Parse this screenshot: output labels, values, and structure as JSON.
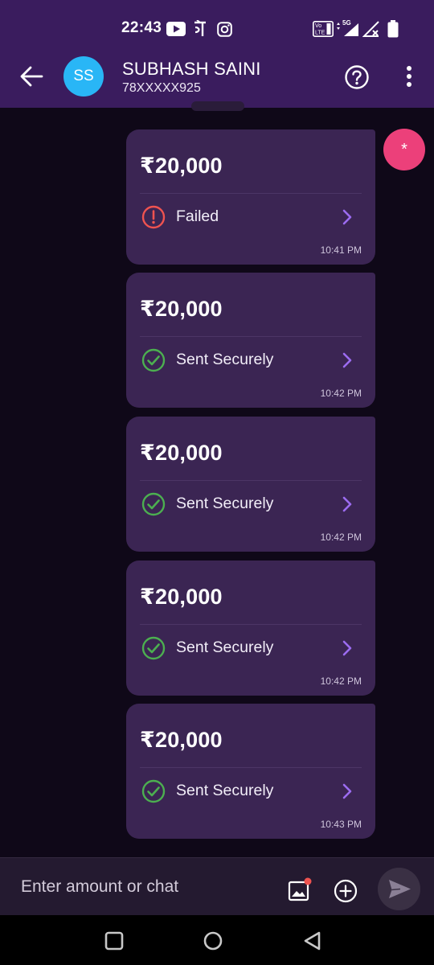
{
  "status_bar": {
    "time": "22:43",
    "icons": [
      "youtube-icon",
      "phonepe-icon",
      "instagram-icon",
      "volte-icon",
      "signal-5g-icon",
      "signal-x-icon",
      "battery-icon"
    ]
  },
  "header": {
    "avatar_initials": "SS",
    "contact_name": "SUBHASH SAINI",
    "contact_phone": "78XXXXX925",
    "icons": [
      "back-arrow-icon",
      "help-icon",
      "more-vert-icon"
    ]
  },
  "fab": {
    "label": "*",
    "color": "#ec407a"
  },
  "transactions": [
    {
      "amount": "₹20,000",
      "status": "Failed",
      "status_type": "failed",
      "time": "10:41 PM"
    },
    {
      "amount": "₹20,000",
      "status": "Sent Securely",
      "status_type": "success",
      "time": "10:42 PM"
    },
    {
      "amount": "₹20,000",
      "status": "Sent Securely",
      "status_type": "success",
      "time": "10:42 PM"
    },
    {
      "amount": "₹20,000",
      "status": "Sent Securely",
      "status_type": "success",
      "time": "10:42 PM"
    },
    {
      "amount": "₹20,000",
      "status": "Sent Securely",
      "status_type": "success",
      "time": "10:43 PM"
    }
  ],
  "input_bar": {
    "placeholder": "Enter amount or chat",
    "icons": [
      "gallery-icon",
      "add-circle-icon",
      "send-icon"
    ]
  },
  "nav_bar": {
    "icons": [
      "recents-square-icon",
      "home-circle-icon",
      "back-triangle-icon"
    ]
  },
  "colors": {
    "header_bg": "#3a1c5e",
    "card_bg": "#3b2553",
    "failed": "#ef5350",
    "success": "#4caf50",
    "accent": "#9c6cf0",
    "avatar": "#29b6f6"
  }
}
